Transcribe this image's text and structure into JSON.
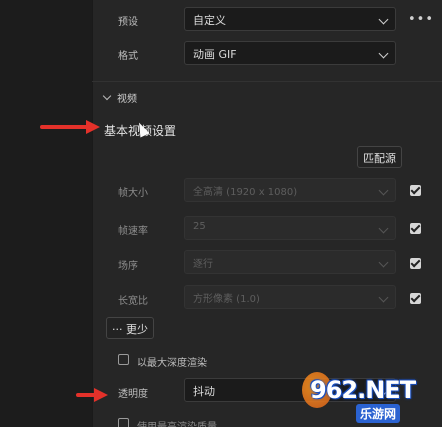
{
  "top": {
    "preset_label": "预设",
    "preset_value": "自定义",
    "format_label": "格式",
    "format_value": "动画 GIF",
    "more_label": "•••"
  },
  "video_section": {
    "title": "视频",
    "subtitle": "基本视频设置",
    "match_source_label": "匹配源",
    "rows": [
      {
        "label": "帧大小",
        "value": "全高清 (1920 x 1080)",
        "checked": true
      },
      {
        "label": "帧速率",
        "value": "25",
        "checked": true
      },
      {
        "label": "场序",
        "value": "逐行",
        "checked": true
      },
      {
        "label": "长宽比",
        "value": "方形像素 (1.0)",
        "checked": true
      }
    ],
    "more_button_label": "··· 更少",
    "max_depth_label": "以最大深度渲染",
    "transparency_label": "透明度",
    "transparency_value": "抖动",
    "bottom_cut_label": "使用最高渲染质量"
  },
  "watermark": {
    "main": "962.NET",
    "sub": "乐游网"
  }
}
